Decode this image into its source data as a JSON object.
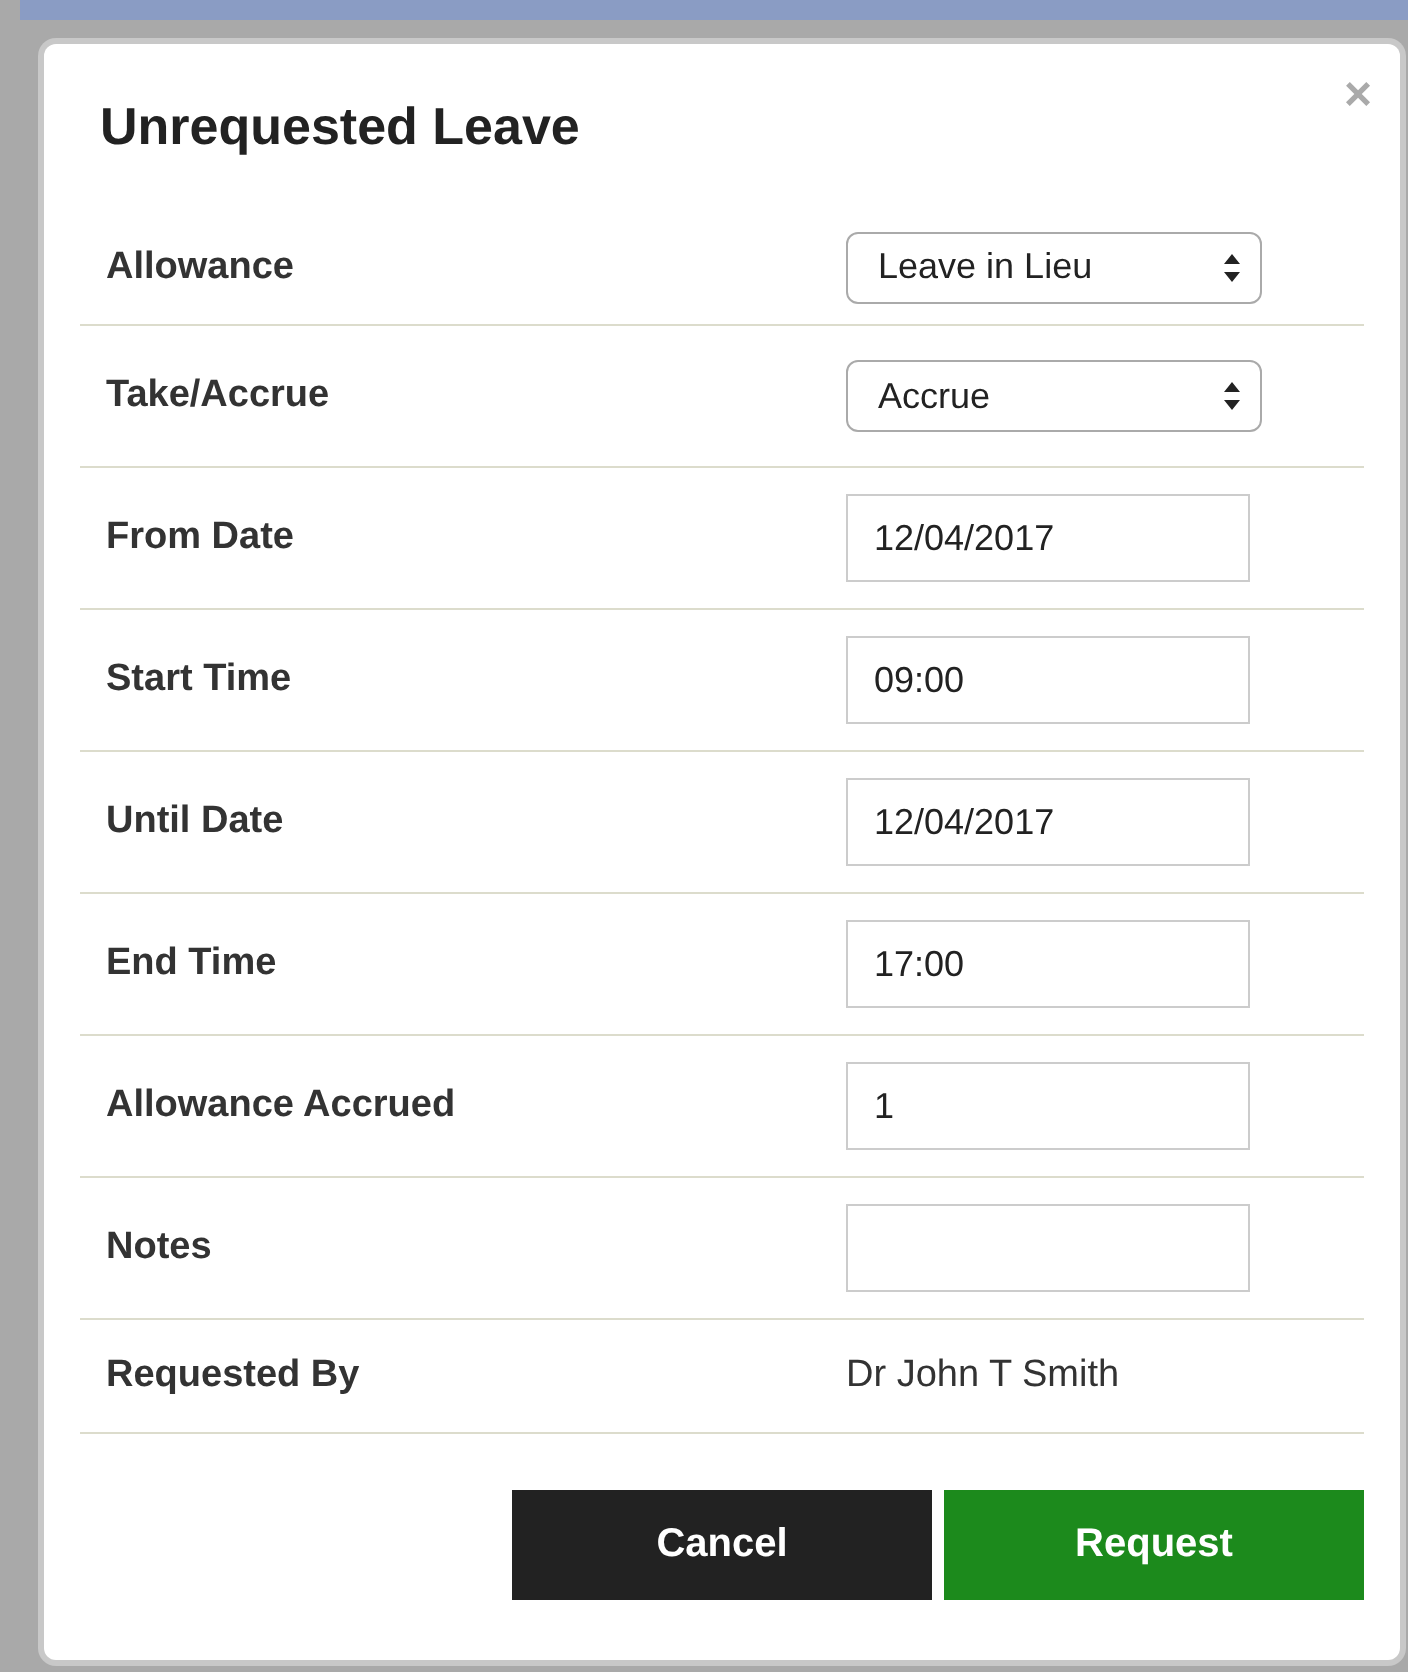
{
  "dialog": {
    "title": "Unrequested Leave",
    "close": "×"
  },
  "fields": [
    {
      "label": "Allowance",
      "kind": "select",
      "value": "Leave in Lieu"
    },
    {
      "label": "Take/Accrue",
      "kind": "select",
      "value": "Accrue"
    },
    {
      "label": "From Date",
      "kind": "input",
      "value": "12/04/2017"
    },
    {
      "label": "Start Time",
      "kind": "input",
      "value": "09:00"
    },
    {
      "label": "Until Date",
      "kind": "input",
      "value": "12/04/2017"
    },
    {
      "label": "End Time",
      "kind": "input",
      "value": "17:00"
    },
    {
      "label": "Allowance Accrued",
      "kind": "input",
      "value": "1"
    },
    {
      "label": "Notes",
      "kind": "input"
    },
    {
      "label": "Requested By",
      "kind": "text",
      "value": "Dr John T Smith"
    }
  ],
  "buttons": [
    {
      "label": "Cancel",
      "kind": "secondary"
    },
    {
      "label": "Request",
      "kind": "primary"
    }
  ]
}
